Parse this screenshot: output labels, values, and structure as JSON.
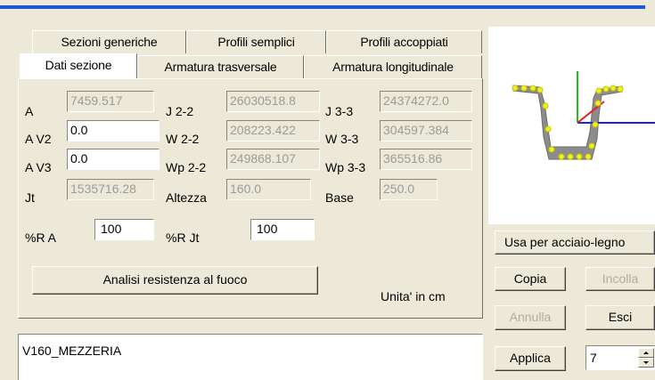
{
  "tabs": {
    "row_back": [
      "Sezioni generiche",
      "Profili semplici",
      "Profili accoppiati"
    ],
    "row_front": [
      "Dati sezione",
      "Armatura trasversale",
      "Armatura longitudinale"
    ]
  },
  "section": {
    "A": {
      "label": "A",
      "value": "7459.517"
    },
    "J22": {
      "label": "J 2-2",
      "value": "26030518.8"
    },
    "J33": {
      "label": "J 3-3",
      "value": "24374272.0"
    },
    "AV2": {
      "label": "A V2",
      "value": "0.0"
    },
    "W22": {
      "label": "W 2-2",
      "value": "208223.422"
    },
    "W33": {
      "label": "W 3-3",
      "value": "304597.384"
    },
    "AV3": {
      "label": "A V3",
      "value": "0.0"
    },
    "Wp22": {
      "label": "Wp 2-2",
      "value": "249868.107"
    },
    "Wp33": {
      "label": "Wp 3-3",
      "value": "365516.86"
    },
    "Jt": {
      "label": "Jt",
      "value": "1535716.28"
    },
    "Altezza": {
      "label": "Altezza",
      "value": "160.0"
    },
    "Base": {
      "label": "Base",
      "value": "250.0"
    },
    "RA": {
      "label": "%R A",
      "value": "100"
    },
    "RJt": {
      "label": "%R Jt",
      "value": "100"
    }
  },
  "fire_button": "Analisi resistenza al fuoco",
  "units_note": "Unita' in cm",
  "section_name": "V160_MEZZERIA",
  "side": {
    "steel_wood": "Usa per acciaio-legno",
    "copy": "Copia",
    "paste": "Incolla",
    "undo": "Annulla",
    "exit": "Esci",
    "apply": "Applica",
    "spin_value": "7"
  },
  "colors": {
    "title_blue": "#2256d8",
    "axis_red": "#e02020",
    "axis_green": "#20c020",
    "axis_blue": "#2020e0",
    "profile_gray": "#8c8c8c",
    "point_yellow": "#f0f020"
  }
}
